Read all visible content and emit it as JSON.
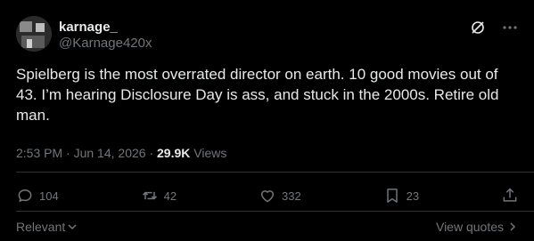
{
  "user": {
    "display_name": "karnage_",
    "handle": "@Karnage420x"
  },
  "tweet": {
    "text": "Spielberg is the most overrated director on earth. 10 good movies out of 43. I’m hearing Disclosure Day is ass, and stuck in the 2000s. Retire old man.",
    "time": "2:53 PM",
    "date": "Jun 14, 2026",
    "separator": "·",
    "views_count": "29.9K",
    "views_label": "Views"
  },
  "actions": {
    "replies": "104",
    "reposts": "42",
    "likes": "332",
    "bookmarks": "23"
  },
  "footer": {
    "sort_label": "Relevant",
    "view_quotes_label": "View quotes"
  },
  "icons": {
    "grok": "grok-icon",
    "more": "more-icon",
    "reply": "reply-icon",
    "repost": "repost-icon",
    "like": "heart-icon",
    "bookmark": "bookmark-icon",
    "share": "share-icon"
  },
  "colors": {
    "background": "#000000",
    "text": "#e7e9ea",
    "muted": "#71767b",
    "divider": "#2f3336"
  }
}
